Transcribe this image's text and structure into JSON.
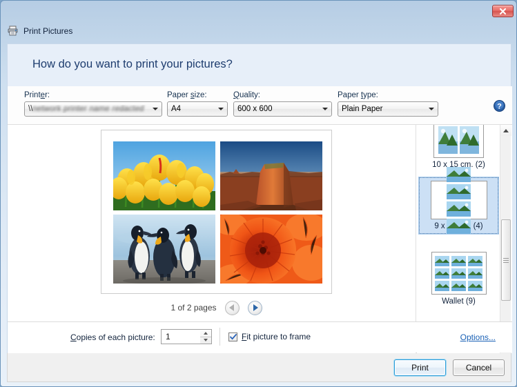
{
  "window": {
    "title": "Print Pictures",
    "title_icon": "printer-icon",
    "close_label": "✕"
  },
  "heading": {
    "text": "How do you want to print your pictures?"
  },
  "options_bar": {
    "printer": {
      "label": "Printer:",
      "value_prefix": "\\\\",
      "value": "network printer name redacted",
      "redacted": true
    },
    "paper_size": {
      "label": "Paper size:",
      "value": "A4"
    },
    "quality": {
      "label": "Quality:",
      "value": "600 x 600"
    },
    "paper_type": {
      "label": "Paper type:",
      "value": "Plain Paper"
    },
    "help_icon": "help-question-icon"
  },
  "preview": {
    "page_indicator": "1 of 2 pages",
    "prev_icon": "chevron-left-icon",
    "next_icon": "chevron-right-icon",
    "prev_enabled": false,
    "next_enabled": true,
    "photos": [
      {
        "name": "yellow-tulips",
        "alt": "Yellow tulips against blue sky"
      },
      {
        "name": "desert-butte",
        "alt": "Red rock butte in desert at sunset"
      },
      {
        "name": "king-penguins",
        "alt": "Three king penguins on a beach"
      },
      {
        "name": "orange-chrysanthemum",
        "alt": "Close-up of orange chrysanthemum flower"
      }
    ]
  },
  "layouts": {
    "items": [
      {
        "caption": "10 x 15 cm. (2)",
        "count": 2,
        "cols": 2,
        "rows": 1,
        "selected": false
      },
      {
        "caption": "9 x 13 cm. (4)",
        "count": 4,
        "cols": 2,
        "rows": 2,
        "selected": true
      },
      {
        "caption": "Wallet (9)",
        "count": 9,
        "cols": 3,
        "rows": 3,
        "selected": false
      }
    ],
    "scrollbar": {
      "up_icon": "scroll-up-arrow-icon",
      "down_icon": "scroll-down-arrow-icon"
    }
  },
  "bottom_controls": {
    "copies_label": "Copies of each picture:",
    "copies_value": "1",
    "fit_label": "Fit picture to frame",
    "fit_checked": true,
    "options_link": "Options..."
  },
  "footer": {
    "print_label": "Print",
    "cancel_label": "Cancel"
  },
  "colors": {
    "accent_blue": "#2c9bd6",
    "link_blue": "#1960b5",
    "heading_blue": "#1d3c6e",
    "selection_blue": "#cce0f5",
    "close_red": "#d7544f"
  }
}
